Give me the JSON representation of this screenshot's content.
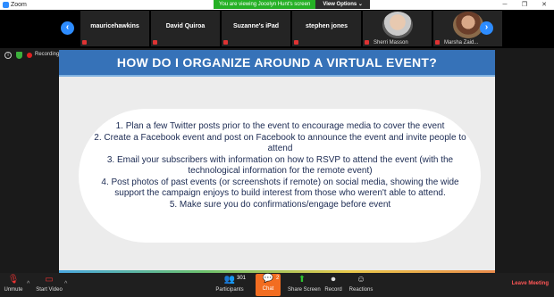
{
  "window": {
    "title": "Zoom",
    "controls": [
      "─",
      "❐",
      "✕"
    ]
  },
  "share": {
    "viewing_text": "You are viewing Jocelyn Hunt's screen",
    "view_options": "View Options ⌄"
  },
  "gallery": {
    "prev": "‹",
    "next": "›",
    "participants": [
      {
        "name": "mauricehawkins",
        "has_video": false
      },
      {
        "name": "David Quiroa",
        "has_video": false
      },
      {
        "name": "Suzanne's iPad",
        "has_video": false
      },
      {
        "name": "stephen jones",
        "has_video": false
      },
      {
        "name": "Sherri Masson",
        "has_video": true
      },
      {
        "name": "Marsha Zaid...",
        "has_video": true
      }
    ]
  },
  "status": {
    "info": "i",
    "recording": "Recording"
  },
  "slide": {
    "title": "HOW DO I ORGANIZE AROUND A VIRTUAL EVENT?",
    "items": [
      "1.   Plan a few Twitter posts prior to the event to encourage media to cover the event",
      "2.   Create a Facebook event and post on Facebook to announce the event and invite people to attend",
      "3.   Email your subscribers with information on how to RSVP to attend the event (with the technological information for the remote event)",
      "4.   Post photos of past events (or screenshots if remote) on social media, showing the wide support the campaign enjoys to build interest from those who weren't able to attend.",
      "5.   Make sure you do confirmations/engage before event"
    ]
  },
  "controls": {
    "unmute": "Unmute",
    "start_video": "Start Video",
    "participants": "Participants",
    "participants_count": "301",
    "chat": "Chat",
    "chat_count": "2",
    "share_screen": "Share Screen",
    "record": "Record",
    "reactions": "Reactions",
    "leave": "Leave Meeting"
  },
  "colors": {
    "accent": "#2d8cff",
    "slide_header": "#3672b8",
    "chat_active": "#f26d21",
    "leave": "#ff5656",
    "recording": "#e02020"
  }
}
